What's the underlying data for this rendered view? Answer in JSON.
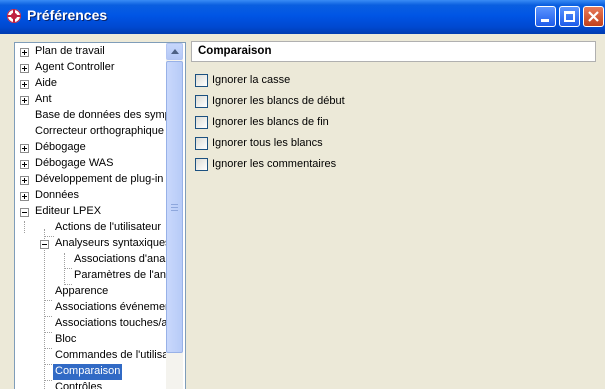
{
  "window": {
    "title": "Préférences"
  },
  "tree": {
    "items": [
      {
        "label": "Plan de travail",
        "expander": "+"
      },
      {
        "label": "Agent Controller",
        "expander": "+"
      },
      {
        "label": "Aide",
        "expander": "+"
      },
      {
        "label": "Ant",
        "expander": "+"
      },
      {
        "label": "Base de données des symp",
        "expander": ""
      },
      {
        "label": "Correcteur orthographique",
        "expander": ""
      },
      {
        "label": "Débogage",
        "expander": "+"
      },
      {
        "label": "Débogage WAS",
        "expander": "+"
      },
      {
        "label": "Développement de plug-in",
        "expander": "+"
      },
      {
        "label": "Données",
        "expander": "+"
      },
      {
        "label": "Editeur LPEX",
        "expander": "-"
      },
      {
        "label": "Actions de l'utilisateur",
        "expander": ""
      },
      {
        "label": "Analyseurs syntaxiques",
        "expander": "-"
      },
      {
        "label": "Associations d'anal",
        "expander": ""
      },
      {
        "label": "Paramètres de l'ana",
        "expander": ""
      },
      {
        "label": "Apparence",
        "expander": ""
      },
      {
        "label": "Associations événemen",
        "expander": ""
      },
      {
        "label": "Associations touches/a",
        "expander": ""
      },
      {
        "label": "Bloc",
        "expander": ""
      },
      {
        "label": "Commandes de l'utilisat",
        "expander": ""
      },
      {
        "label": "Comparaison",
        "expander": "",
        "selected": true
      },
      {
        "label": "Contrôles",
        "expander": ""
      }
    ]
  },
  "page": {
    "title": "Comparaison",
    "options": [
      {
        "label": "Ignorer la casse",
        "checked": false
      },
      {
        "label": "Ignorer les blancs de début",
        "checked": false
      },
      {
        "label": "Ignorer les blancs de fin",
        "checked": false
      },
      {
        "label": "Ignorer tous les blancs",
        "checked": false
      },
      {
        "label": "Ignorer les commentaires",
        "checked": false
      }
    ]
  },
  "colors": {
    "titlebar": "#0055e5",
    "selection": "#316ac5",
    "dialog_bg": "#ece9d8"
  }
}
